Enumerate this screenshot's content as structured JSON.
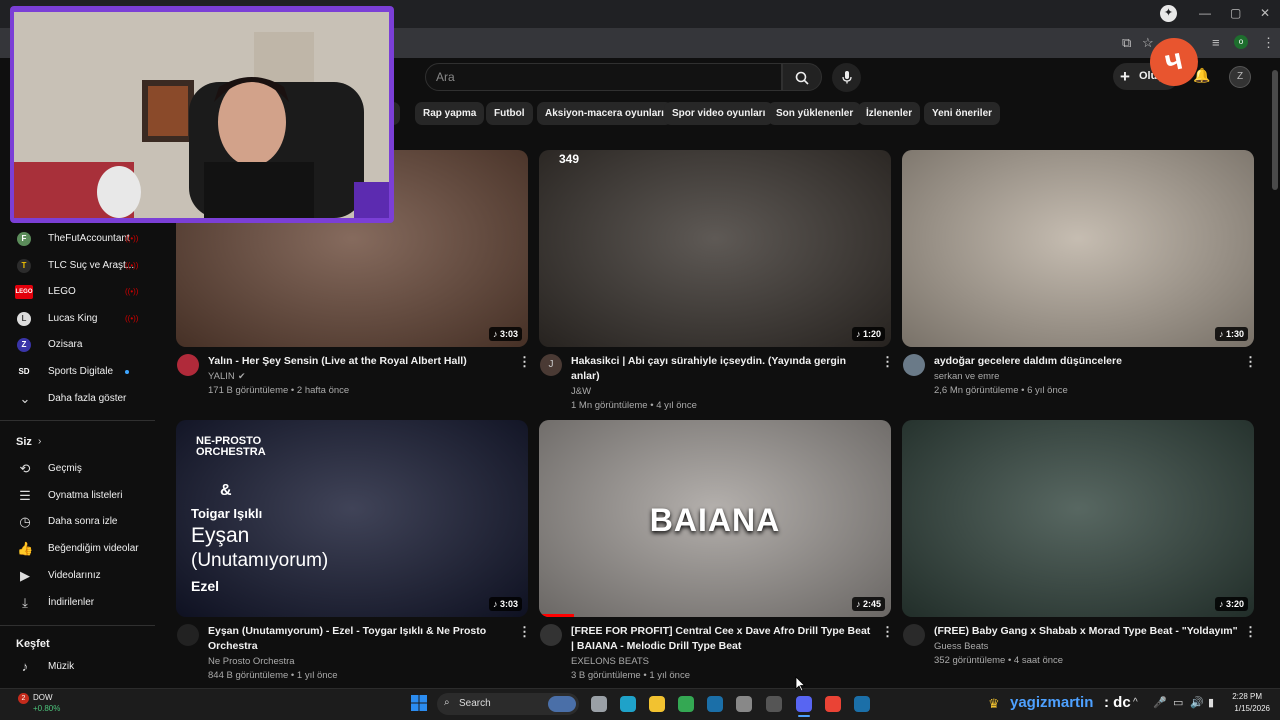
{
  "search": {
    "placeholder": "Ara"
  },
  "header": {
    "create_label": "Oluştur",
    "logo_glyph": "ч"
  },
  "chips": [
    "lı",
    "Rap yapma",
    "Futbol",
    "Aksiyon-macera oyunları",
    "Spor video oyunları",
    "Son yüklenenler",
    "İzlenenler",
    "Yeni öneriler"
  ],
  "sidebar": {
    "subscriptions": [
      {
        "label": "TheFutAccountant",
        "badge": "live",
        "icon": "F"
      },
      {
        "label": "TLC Suç ve Araşt...",
        "badge": "live",
        "icon": "T"
      },
      {
        "label": "LEGO",
        "badge": "live",
        "icon": "LEGO"
      },
      {
        "label": "Lucas King",
        "badge": "live",
        "icon": "L"
      },
      {
        "label": "Ozisara",
        "badge": "",
        "icon": "Z"
      },
      {
        "label": "Sports Digitale",
        "badge": "dot",
        "icon": "SD"
      }
    ],
    "show_more": "Daha fazla göster",
    "you_header": "Siz",
    "you_items": [
      {
        "label": "Geçmiş",
        "icon": "history-icon",
        "glyph": "⟲"
      },
      {
        "label": "Oynatma listeleri",
        "icon": "playlist-icon",
        "glyph": "☰"
      },
      {
        "label": "Daha sonra izle",
        "icon": "clock-icon",
        "glyph": "◷"
      },
      {
        "label": "Beğendiğim videolar",
        "icon": "thumb-up-icon",
        "glyph": "👍"
      },
      {
        "label": "Videolarınız",
        "icon": "video-icon",
        "glyph": "▶"
      },
      {
        "label": "İndirilenler",
        "icon": "download-icon",
        "glyph": "⤓"
      }
    ],
    "explore_header": "Keşfet",
    "explore_items": [
      {
        "label": "Müzik",
        "icon": "music-icon",
        "glyph": "♪"
      }
    ]
  },
  "videos": [
    {
      "title": "Yalın - Her Şey Sensin (Live at the Royal Albert Hall)",
      "channel": "YALIN",
      "verified": true,
      "views": "171 B görüntüleme",
      "age": "2 hafta önce",
      "duration": "3:03",
      "thumb_color": "#6b4a3a",
      "avatar_color": "#b02a3a"
    },
    {
      "title": "Hakasikci | Abi çayı sürahiyle içseydin. (Yayında gergin anlar)",
      "channel": "J&W",
      "verified": false,
      "views": "1 Mn görüntüleme",
      "age": "4 yıl önce",
      "duration": "1:20",
      "thumb_color": "#3b3530",
      "avatar_color": "#4a3a34",
      "overlay_count": "349",
      "avatar_letter": "J"
    },
    {
      "title": "aydoğar gecelere daldım düşüncelere",
      "channel": "serkan ve emre",
      "verified": false,
      "views": "2,6 Mn görüntüleme",
      "age": "6 yıl önce",
      "duration": "1:30",
      "thumb_color": "#b9aea0",
      "avatar_color": "#6a7a88"
    },
    {
      "title": "Eyşan (Unutamıyorum) - Ezel - Toygar Işıklı & Ne Prosto Orchestra",
      "channel": "Ne Prosto Orchestra",
      "verified": false,
      "views": "844 B görüntüleme",
      "age": "1 yıl önce",
      "duration": "3:03",
      "thumb_color": "#161a33",
      "avatar_color": "#222",
      "thumb_text": {
        "brand": "NE-PROSTO ORCHESTRA",
        "amp": "&",
        "artist": "Toigar Işıklı",
        "song": "Eyşan",
        "sub": "(Unutamıyorum)",
        "show": "Ezel"
      }
    },
    {
      "title": "[FREE FOR PROFIT]  Central Cee x Dave Afro Drill Type Beat | BAIANA - Melodic Drill Type Beat",
      "channel": "EXELONS BEATS",
      "verified": false,
      "views": "3 B görüntüleme",
      "age": "1 yıl önce",
      "duration": "2:45",
      "thumb_color": "#a39e9a",
      "avatar_color": "#333",
      "thumb_word": "BAIANA",
      "progress": 0.1
    },
    {
      "title": "(FREE) Baby Gang x Shabab x Morad Type Beat - \"Yoldayım\"",
      "channel": "Guess Beats",
      "verified": false,
      "views": "352 görüntüleme",
      "age": "4 saat önce",
      "duration": "3:20",
      "thumb_color": "#33463f",
      "avatar_color": "#2a2a2a"
    }
  ],
  "taskbar": {
    "stock_name": "DOW",
    "stock_change": "+0.80%",
    "stock_badge": "2",
    "search_label": "Search",
    "channel_name": "yagizmartin",
    "channel_suffix": ": dc",
    "time": "2:28 PM",
    "date": "1/15/2026"
  }
}
